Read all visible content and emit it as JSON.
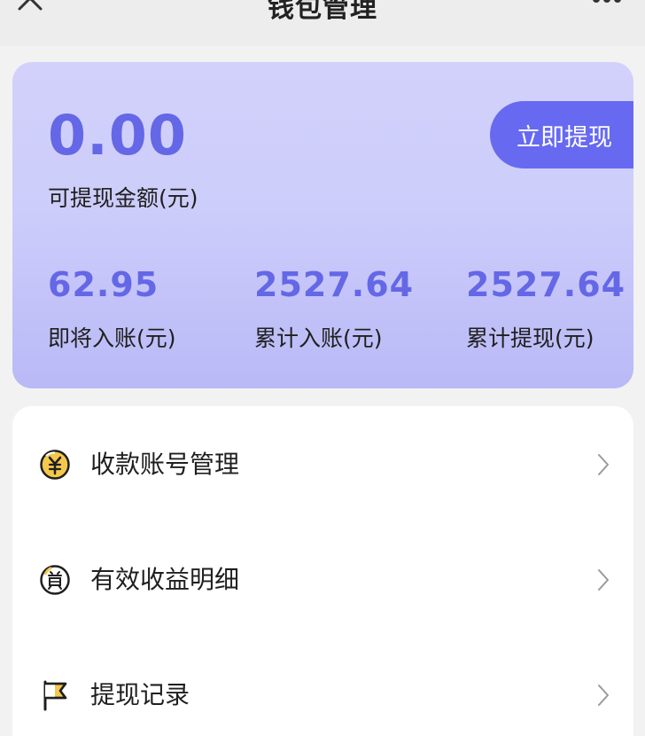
{
  "header": {
    "title": "钱包管理",
    "back_icon": "back-chevron-icon",
    "more_icon": "more-dots-icon"
  },
  "wallet": {
    "withdrawable_amount": "0.00",
    "withdrawable_label": "可提现金额(元)",
    "withdraw_button_label": "立即提现",
    "stats": [
      {
        "value": "62.95",
        "label": "即将入账(元)"
      },
      {
        "value": "2527.64",
        "label": "累计入账(元)"
      },
      {
        "value": "2527.64",
        "label": "累计提现(元)"
      }
    ]
  },
  "menu": {
    "items": [
      {
        "label": "收款账号管理",
        "icon": "yuan-coin-icon"
      },
      {
        "label": "有效收益明细",
        "icon": "reward-badge-icon"
      },
      {
        "label": "提现记录",
        "icon": "flag-icon"
      }
    ]
  },
  "colors": {
    "accent": "#676af0",
    "amount_text": "#6467e6",
    "card_bg_top": "#d2d1fb",
    "card_bg_bottom": "#b9b9f7",
    "icon_yellow": "#f5c84c"
  }
}
